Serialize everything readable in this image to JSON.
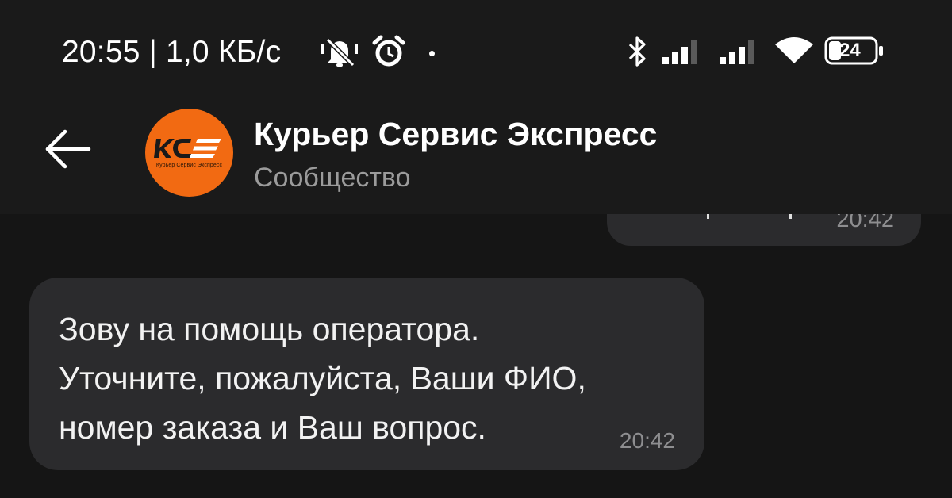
{
  "status_bar": {
    "text": "20:55 | 1,0 КБ/с",
    "battery": "24",
    "icons": [
      "bell-muted-icon",
      "alarm-icon",
      "dot-icon",
      "bluetooth-icon",
      "signal-1-icon",
      "signal-2-icon",
      "wifi-icon",
      "battery-icon"
    ]
  },
  "header": {
    "back_icon": "arrow-left-icon",
    "avatar_caption": "Курьер Сервис Экспресс",
    "title": "Курьер Сервис Экспресс",
    "subtitle": "Сообщество"
  },
  "messages": {
    "outgoing_time": "20:42",
    "incoming_text": "Зову на помощь оператора.\nУточните, пожалуйста, Ваши ФИО,\nномер заказа и Ваш вопрос.",
    "incoming_time": "20:42"
  },
  "colors": {
    "background": "#151515",
    "header": "#1a1a1a",
    "bubble": "#2b2b2d",
    "avatar": "#f26a12",
    "muted_text": "#9b9b9b"
  }
}
